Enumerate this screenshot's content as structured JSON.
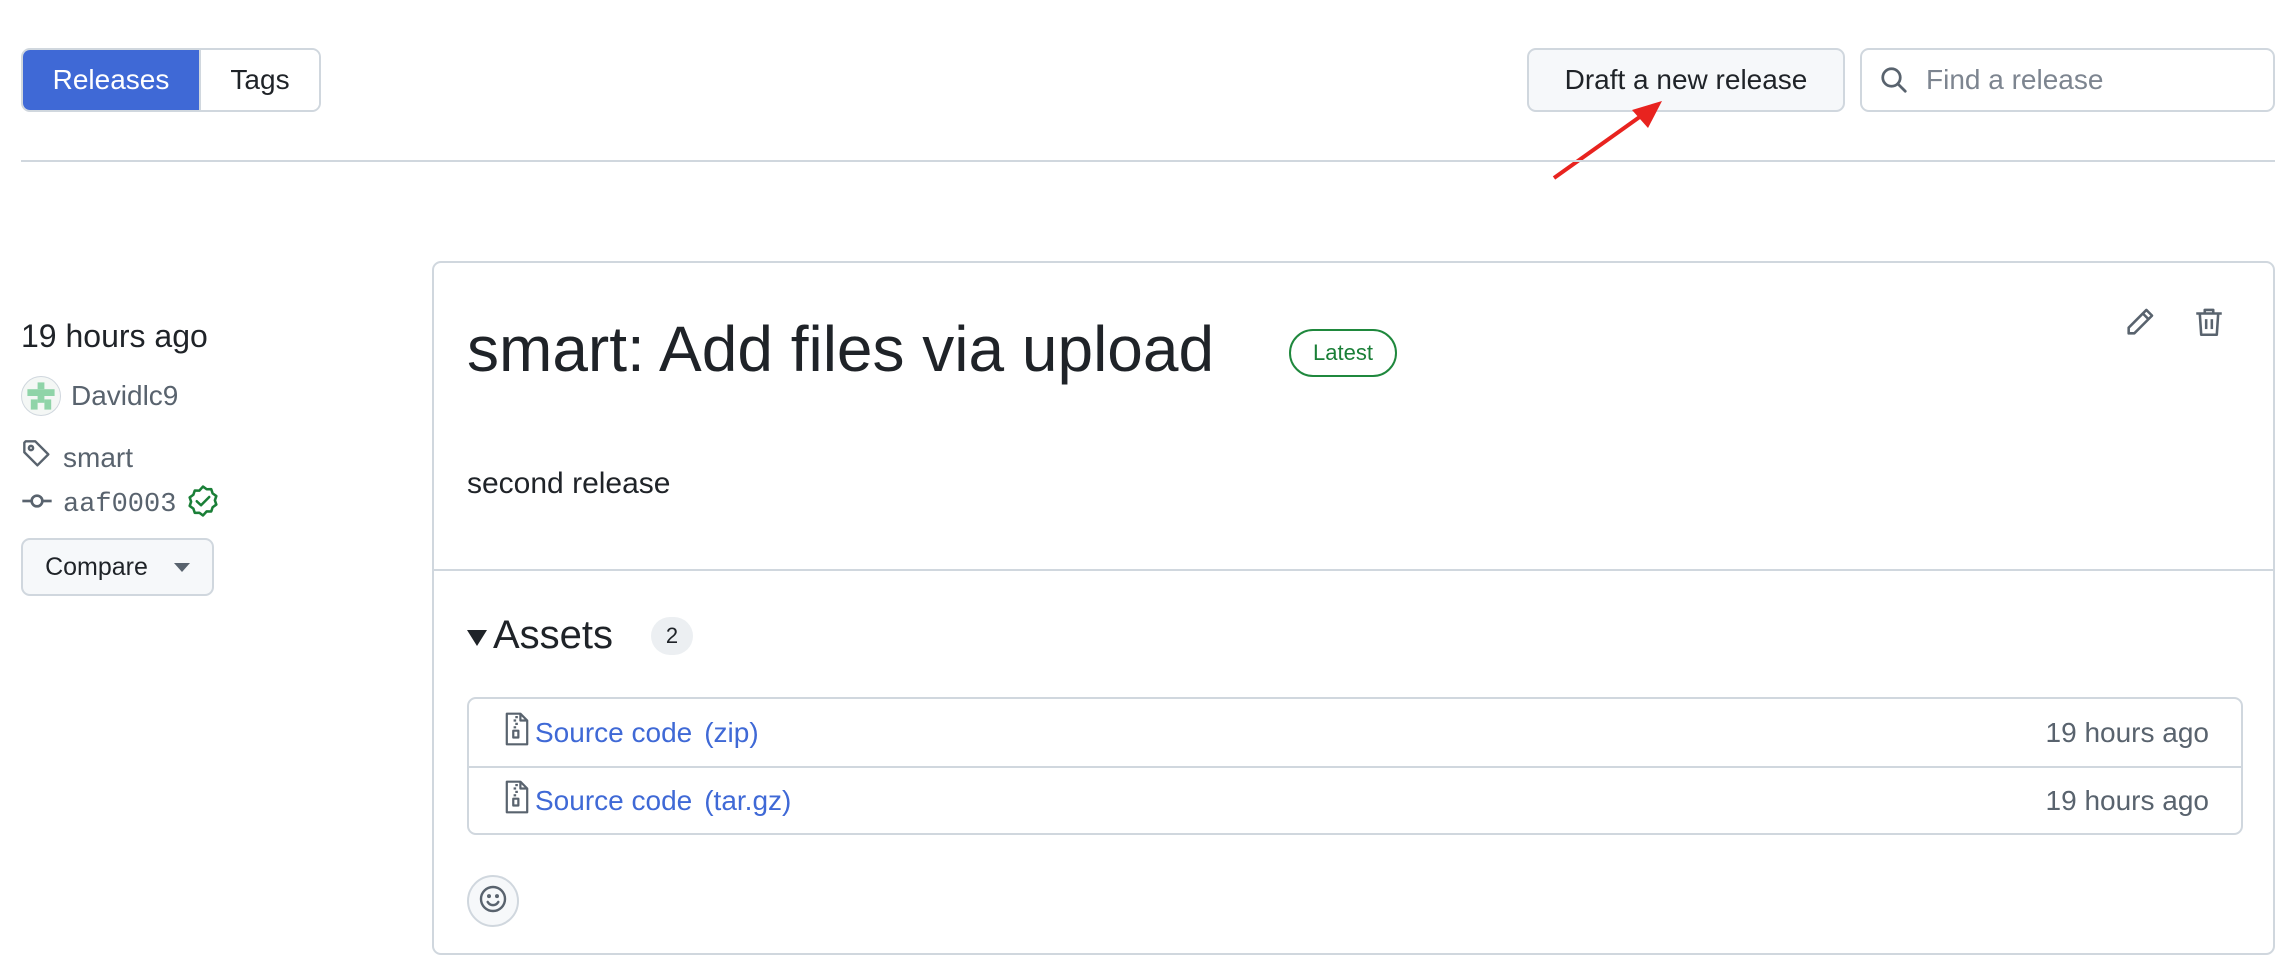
{
  "tabs": [
    {
      "label": "Releases",
      "active": true
    },
    {
      "label": "Tags",
      "active": false
    }
  ],
  "toolbar": {
    "draft_label": "Draft a new release",
    "search_placeholder": "Find a release",
    "search_value": ""
  },
  "release": {
    "time": "19 hours ago",
    "author": "Davidlc9",
    "tag": "smart",
    "commit": "aaf0003",
    "compare_label": "Compare",
    "title": "smart: Add files via upload",
    "badge": "Latest",
    "notes": "second release",
    "assets_label": "Assets",
    "assets_count": "2",
    "assets": [
      {
        "name": "Source code",
        "ext": "(zip)",
        "time": "19 hours ago"
      },
      {
        "name": "Source code",
        "ext": "(tar.gz)",
        "time": "19 hours ago"
      }
    ]
  },
  "colors": {
    "accent": "#3f69d6",
    "success": "#1a7f37",
    "annotation_arrow": "#e8231f"
  },
  "icons": [
    "search-icon",
    "tag-icon",
    "commit-icon",
    "verified-icon",
    "pencil-icon",
    "trash-icon",
    "file-zip-icon",
    "smiley-icon",
    "arrow-annotation"
  ]
}
